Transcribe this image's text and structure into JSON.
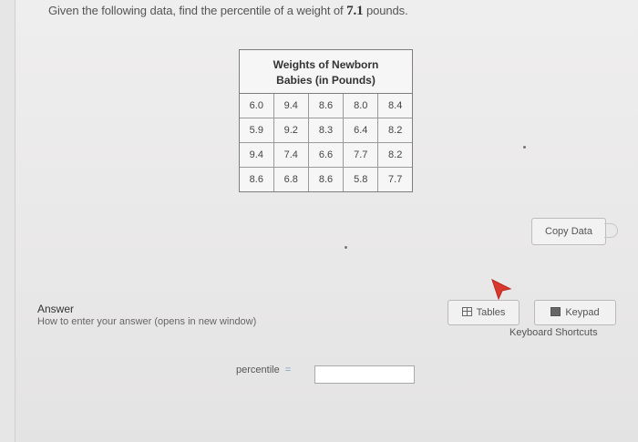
{
  "question": {
    "prefix": "Given the following data, find the percentile of a weight of",
    "value": "7.1",
    "suffix": "pounds."
  },
  "table": {
    "title_line1": "Weights of Newborn",
    "title_line2": "Babies (in Pounds)",
    "rows": [
      [
        "6.0",
        "9.4",
        "8.6",
        "8.0",
        "8.4"
      ],
      [
        "5.9",
        "9.2",
        "8.3",
        "6.4",
        "8.2"
      ],
      [
        "9.4",
        "7.4",
        "6.6",
        "7.7",
        "8.2"
      ],
      [
        "8.6",
        "6.8",
        "8.6",
        "5.8",
        "7.7"
      ]
    ]
  },
  "buttons": {
    "copy_data": "Copy Data",
    "tables": "Tables",
    "keypad": "Keypad",
    "keyboard_shortcuts": "Keyboard Shortcuts"
  },
  "answer": {
    "label": "Answer",
    "help_link": "How to enter your answer (opens in new window)",
    "field_label": "percentile",
    "equals": "=",
    "value": ""
  },
  "icons": {
    "tables": "table-grid-icon",
    "keypad": "keypad-icon",
    "cursor": "mouse-pointer-icon"
  },
  "colors": {
    "cursor": "#d9382f",
    "equals": "#7a9ec7"
  }
}
